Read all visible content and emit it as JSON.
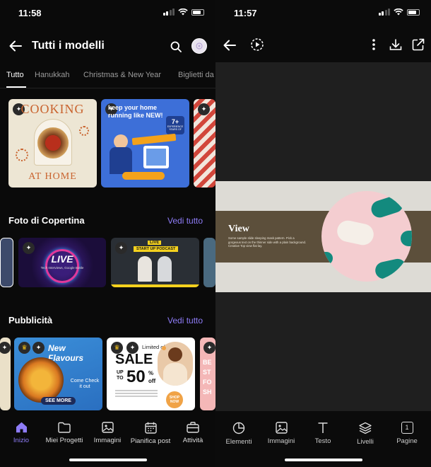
{
  "left_screen": {
    "status": {
      "time": "11:58"
    },
    "header": {
      "title": "Tutti i modelli",
      "back_icon": "arrow-left-icon",
      "search_icon": "search-icon"
    },
    "tabs": [
      "Tutto",
      "Hanukkah",
      "Christmas & New Year",
      "Biglietti da"
    ],
    "featured": {
      "card1": {
        "line1": "COOKING",
        "line2": "AT HOME"
      },
      "card2": {
        "headline": "keep your home running like NEW!",
        "badge_num": "7+",
        "badge_text": "EXPERIENCE YEARS OF"
      }
    },
    "section_cover": {
      "title": "Foto di Copertina",
      "see_all": "Vedi tutto",
      "card_live": {
        "title": "LIVE",
        "subtitle": "Tech Interviews, Google Bottle"
      },
      "card_podcast": {
        "tag": "LIVE",
        "title": "START UP PODCAST"
      }
    },
    "section_ads": {
      "title": "Pubblicità",
      "see_all": "Vedi tutto",
      "card_flavours": {
        "title": "New Flavours",
        "sub": "Come Check it out",
        "cta": "SEE MORE"
      },
      "card_sale": {
        "top": "Limited offer",
        "sale": "SALE",
        "upto": "UP TO",
        "pct": "50",
        "pct_sign": "%",
        "off": "off",
        "shop": "SHOP NOW"
      },
      "card_partial": {
        "text": "BE ST FO SH"
      }
    },
    "nav": [
      {
        "label": "Inizio",
        "icon": "home-icon"
      },
      {
        "label": "Miei Progetti",
        "icon": "folder-icon"
      },
      {
        "label": "Immagini",
        "icon": "image-icon"
      },
      {
        "label": "Pianifica post",
        "icon": "calendar-icon"
      },
      {
        "label": "Attività",
        "icon": "briefcase-icon"
      }
    ],
    "colors": {
      "accent": "#8e7cf7"
    }
  },
  "right_screen": {
    "status": {
      "time": "11:57"
    },
    "banner": {
      "title": "View",
      "body": "Some sample slide sleeping mask pattern. Pick a gorgeous text on the thinner side with a plain background. Creative Top view flat lay."
    },
    "tools": [
      {
        "label": "Elementi",
        "icon": "shapes-icon"
      },
      {
        "label": "Immagini",
        "icon": "image-icon"
      },
      {
        "label": "Testo",
        "icon": "text-icon"
      },
      {
        "label": "Livelli",
        "icon": "layers-icon"
      },
      {
        "label": "Pagine",
        "icon": "pages-icon",
        "badge": "1"
      }
    ]
  }
}
